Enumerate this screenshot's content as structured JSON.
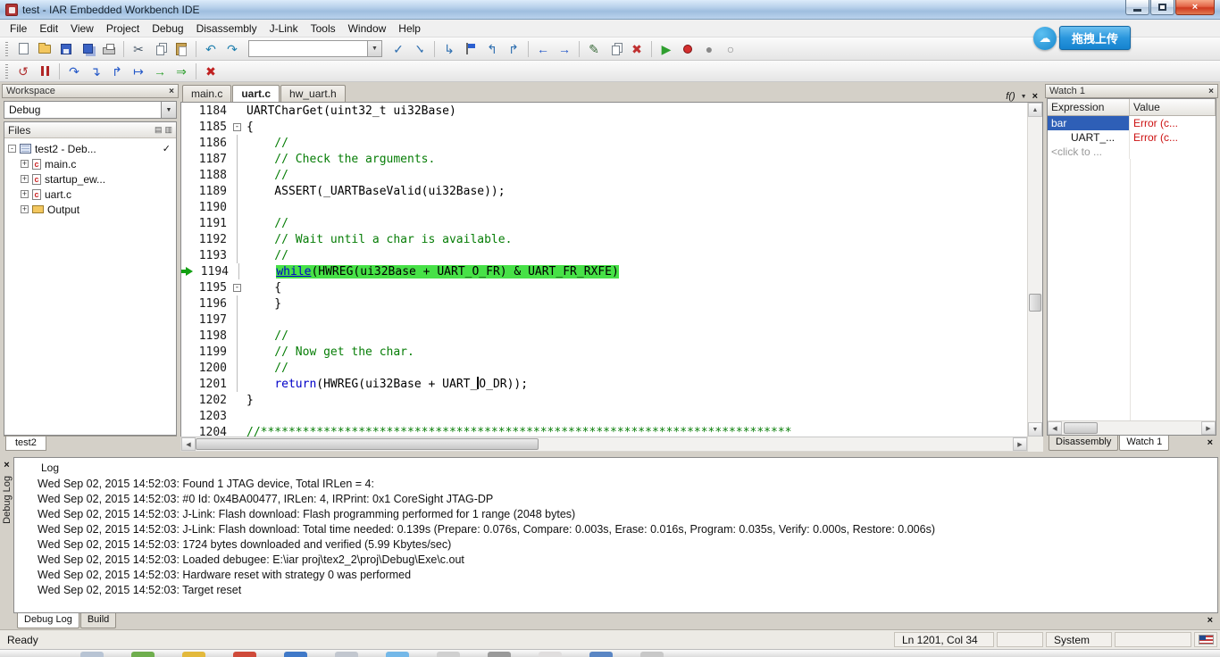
{
  "window": {
    "title": "test - IAR Embedded Workbench IDE"
  },
  "overlay": {
    "upload_label": "拖拽上传"
  },
  "menu": {
    "items": [
      "File",
      "Edit",
      "View",
      "Project",
      "Debug",
      "Disassembly",
      "J-Link",
      "Tools",
      "Window",
      "Help"
    ]
  },
  "toolbar_main": {
    "buttons": [
      {
        "name": "new-document-button",
        "shape": "doc"
      },
      {
        "name": "open-file-button",
        "shape": "folder"
      },
      {
        "name": "save-button",
        "shape": "floppy"
      },
      {
        "name": "save-all-button",
        "shape": "floppy2"
      },
      {
        "name": "print-button",
        "shape": "printer"
      },
      {
        "sep": true
      },
      {
        "name": "cut-button",
        "glyph": "✂",
        "color": "#4a5a6a"
      },
      {
        "name": "copy-button",
        "shape": "copy"
      },
      {
        "name": "paste-button",
        "shape": "paste"
      },
      {
        "sep": true
      },
      {
        "name": "undo-button",
        "glyph": "↶",
        "color": "#1f7fae"
      },
      {
        "name": "redo-button",
        "glyph": "↷",
        "color": "#1f7fae"
      },
      {
        "combo": true,
        "name": "find-combobox"
      },
      {
        "name": "find-next-button",
        "glyph": "✓",
        "color": "#2f6fb0"
      },
      {
        "name": "find-previous-button",
        "glyph": "✓",
        "color": "#2f6fb0",
        "flip": true
      },
      {
        "sep": true
      },
      {
        "name": "go-to-button",
        "glyph": "↳",
        "color": "#2f6fb0"
      },
      {
        "name": "toggle-bookmark-button",
        "shape": "flag"
      },
      {
        "name": "previous-bookmark-button",
        "glyph": "↰",
        "color": "#2f6fb0"
      },
      {
        "name": "next-bookmark-button",
        "glyph": "↱",
        "color": "#2f6fb0"
      },
      {
        "sep": true
      },
      {
        "name": "navigate-backward-button",
        "glyph": "←",
        "color": "#2458c8"
      },
      {
        "name": "navigate-forward-button",
        "glyph": "→",
        "color": "#2458c8"
      },
      {
        "sep": true
      },
      {
        "name": "compile-button",
        "glyph": "✎",
        "color": "#3a6a3a"
      },
      {
        "name": "make-button",
        "shape": "copy"
      },
      {
        "name": "stop-build-button",
        "glyph": "✖",
        "color": "#c03030"
      },
      {
        "sep": true
      },
      {
        "name": "download-and-debug-button",
        "glyph": "▶",
        "color": "#2f9f2f"
      },
      {
        "name": "toggle-breakpoint-button",
        "shape": "dot-red"
      },
      {
        "name": "enable-breakpoints-button",
        "glyph": "●",
        "color": "#888888"
      },
      {
        "name": "disable-breakpoints-button",
        "glyph": "○",
        "color": "#888888"
      }
    ]
  },
  "toolbar_debug": {
    "buttons": [
      {
        "name": "reset-button",
        "glyph": "↺",
        "color": "#b03030"
      },
      {
        "name": "break-button",
        "shape": "pause"
      },
      {
        "sep": true
      },
      {
        "name": "step-over-button",
        "glyph": "↷",
        "color": "#2458c8"
      },
      {
        "name": "step-into-button",
        "glyph": "↴",
        "color": "#2458c8"
      },
      {
        "name": "step-out-button",
        "glyph": "↱",
        "color": "#2458c8"
      },
      {
        "name": "next-statement-button",
        "glyph": "↦",
        "color": "#2458c8"
      },
      {
        "name": "run-to-cursor-button",
        "glyph": "→",
        "color": "#2f9f2f"
      },
      {
        "name": "go-button",
        "glyph": "⇒",
        "color": "#2f9f2f"
      },
      {
        "sep": true
      },
      {
        "name": "stop-debugging-button",
        "glyph": "✖",
        "color": "#c02020"
      }
    ]
  },
  "workspace": {
    "title": "Workspace",
    "config": "Debug",
    "files_header": "Files",
    "tree": [
      {
        "label": "test2 - Deb...",
        "kind": "project",
        "level": 0,
        "expander": "-",
        "checked": true
      },
      {
        "label": "main.c",
        "kind": "c",
        "level": 1,
        "expander": "+"
      },
      {
        "label": "startup_ew...",
        "kind": "c",
        "level": 1,
        "expander": "+"
      },
      {
        "label": "uart.c",
        "kind": "c",
        "level": 1,
        "expander": "+"
      },
      {
        "label": "Output",
        "kind": "folder",
        "level": 1,
        "expander": "+"
      }
    ],
    "bottom_tab": "test2"
  },
  "editor": {
    "tabs": [
      {
        "label": "main.c"
      },
      {
        "label": "uart.c",
        "active": true
      },
      {
        "label": "hw_uart.h"
      }
    ],
    "function_selector": "f()",
    "lines": [
      {
        "num": 1184,
        "segs": [
          {
            "t": "UARTCharGet(uint32_t ui32Base)",
            "s": "p"
          }
        ]
      },
      {
        "num": 1185,
        "fold": "box",
        "segs": [
          {
            "t": "{",
            "s": "p"
          }
        ]
      },
      {
        "num": 1186,
        "fold": "line",
        "segs": [
          {
            "t": "    //",
            "s": "c"
          }
        ]
      },
      {
        "num": 1187,
        "fold": "line",
        "segs": [
          {
            "t": "    // Check the arguments.",
            "s": "c"
          }
        ]
      },
      {
        "num": 1188,
        "fold": "line",
        "segs": [
          {
            "t": "    //",
            "s": "c"
          }
        ]
      },
      {
        "num": 1189,
        "fold": "line",
        "segs": [
          {
            "t": "    ASSERT(_UARTBaseValid(ui32Base));",
            "s": "p"
          }
        ]
      },
      {
        "num": 1190,
        "fold": "line",
        "segs": []
      },
      {
        "num": 1191,
        "fold": "line",
        "segs": [
          {
            "t": "    //",
            "s": "c"
          }
        ]
      },
      {
        "num": 1192,
        "fold": "line",
        "segs": [
          {
            "t": "    // Wait until a char is available.",
            "s": "c"
          }
        ]
      },
      {
        "num": 1193,
        "fold": "line",
        "segs": [
          {
            "t": "    //",
            "s": "c"
          }
        ]
      },
      {
        "num": 1194,
        "fold": "line",
        "current": true,
        "segs": [
          {
            "t": "    ",
            "s": "p"
          },
          {
            "t": "while",
            "s": "k",
            "hl": true,
            "u": true
          },
          {
            "t": "(HWREG(ui32Base + UART_O_FR) & UART_FR_RXFE)",
            "s": "p",
            "hl": true
          }
        ]
      },
      {
        "num": 1195,
        "fold": "box",
        "segs": [
          {
            "t": "    {",
            "s": "p"
          }
        ]
      },
      {
        "num": 1196,
        "fold": "line",
        "segs": [
          {
            "t": "    }",
            "s": "p"
          }
        ]
      },
      {
        "num": 1197,
        "fold": "line",
        "segs": []
      },
      {
        "num": 1198,
        "fold": "line",
        "segs": [
          {
            "t": "    //",
            "s": "c"
          }
        ]
      },
      {
        "num": 1199,
        "fold": "line",
        "segs": [
          {
            "t": "    // Now get the char.",
            "s": "c"
          }
        ]
      },
      {
        "num": 1200,
        "fold": "line",
        "segs": [
          {
            "t": "    //",
            "s": "c"
          }
        ]
      },
      {
        "num": 1201,
        "fold": "line",
        "segs": [
          {
            "t": "    ",
            "s": "p"
          },
          {
            "t": "return",
            "s": "k"
          },
          {
            "t": "(HWREG(ui32Base + UART_",
            "s": "p"
          },
          {
            "caret": true
          },
          {
            "t": "O_DR));",
            "s": "p"
          }
        ]
      },
      {
        "num": 1202,
        "segs": [
          {
            "t": "}",
            "s": "p"
          }
        ]
      },
      {
        "num": 1203,
        "segs": []
      },
      {
        "num": 1204,
        "segs": [
          {
            "t": "//****************************************************************************",
            "s": "c"
          }
        ]
      }
    ]
  },
  "watch": {
    "title": "Watch 1",
    "columns": [
      "Expression",
      "Value"
    ],
    "rows": [
      {
        "expression": "bar",
        "value": "Error (c...",
        "selected": true,
        "error": true
      },
      {
        "expression": "UART_...",
        "value": "Error (c...",
        "error": true,
        "indent": true
      },
      {
        "expression": "<click to ...",
        "value": "",
        "placeholder": true
      }
    ],
    "tabs": [
      {
        "label": "Disassembly"
      },
      {
        "label": "Watch 1",
        "active": true
      }
    ]
  },
  "log": {
    "title": "Log",
    "side_tab": "Debug Log",
    "tabs": [
      {
        "label": "Debug Log",
        "active": true
      },
      {
        "label": "Build"
      }
    ],
    "lines": [
      "Wed Sep 02, 2015 14:52:03: Found 1 JTAG device, Total IRLen = 4:",
      "Wed Sep 02, 2015 14:52:03: #0 Id: 0x4BA00477, IRLen:  4, IRPrint: 0x1 CoreSight JTAG-DP",
      "Wed Sep 02, 2015 14:52:03: J-Link: Flash download: Flash programming performed for 1 range (2048 bytes)",
      "Wed Sep 02, 2015 14:52:03: J-Link: Flash download: Total time needed: 0.139s (Prepare: 0.076s, Compare: 0.003s, Erase: 0.016s, Program: 0.035s, Verify: 0.000s, Restore: 0.006s)",
      "Wed Sep 02, 2015 14:52:03: 1724 bytes downloaded and verified (5.99 Kbytes/sec)",
      "Wed Sep 02, 2015 14:52:03: Loaded debugee: E:\\iar proj\\tex2_2\\proj\\Debug\\Exe\\c.out",
      "Wed Sep 02, 2015 14:52:03: Hardware reset with strategy 0 was performed",
      "Wed Sep 02, 2015 14:52:03: Target reset"
    ]
  },
  "status": {
    "ready": "Ready",
    "cursor_position": "Ln 1201, Col 34",
    "system": "System"
  },
  "taskbar": {
    "icon_colors": [
      "#b8c4d4",
      "#6fae4e",
      "#e3b93c",
      "#cf4a3a",
      "#4079c8",
      "#c2c7cf",
      "#74b8e8",
      "#d0d0d0",
      "#9a9a9a",
      "#e0dede",
      "#5a86c4",
      "#c8c8c8"
    ]
  }
}
